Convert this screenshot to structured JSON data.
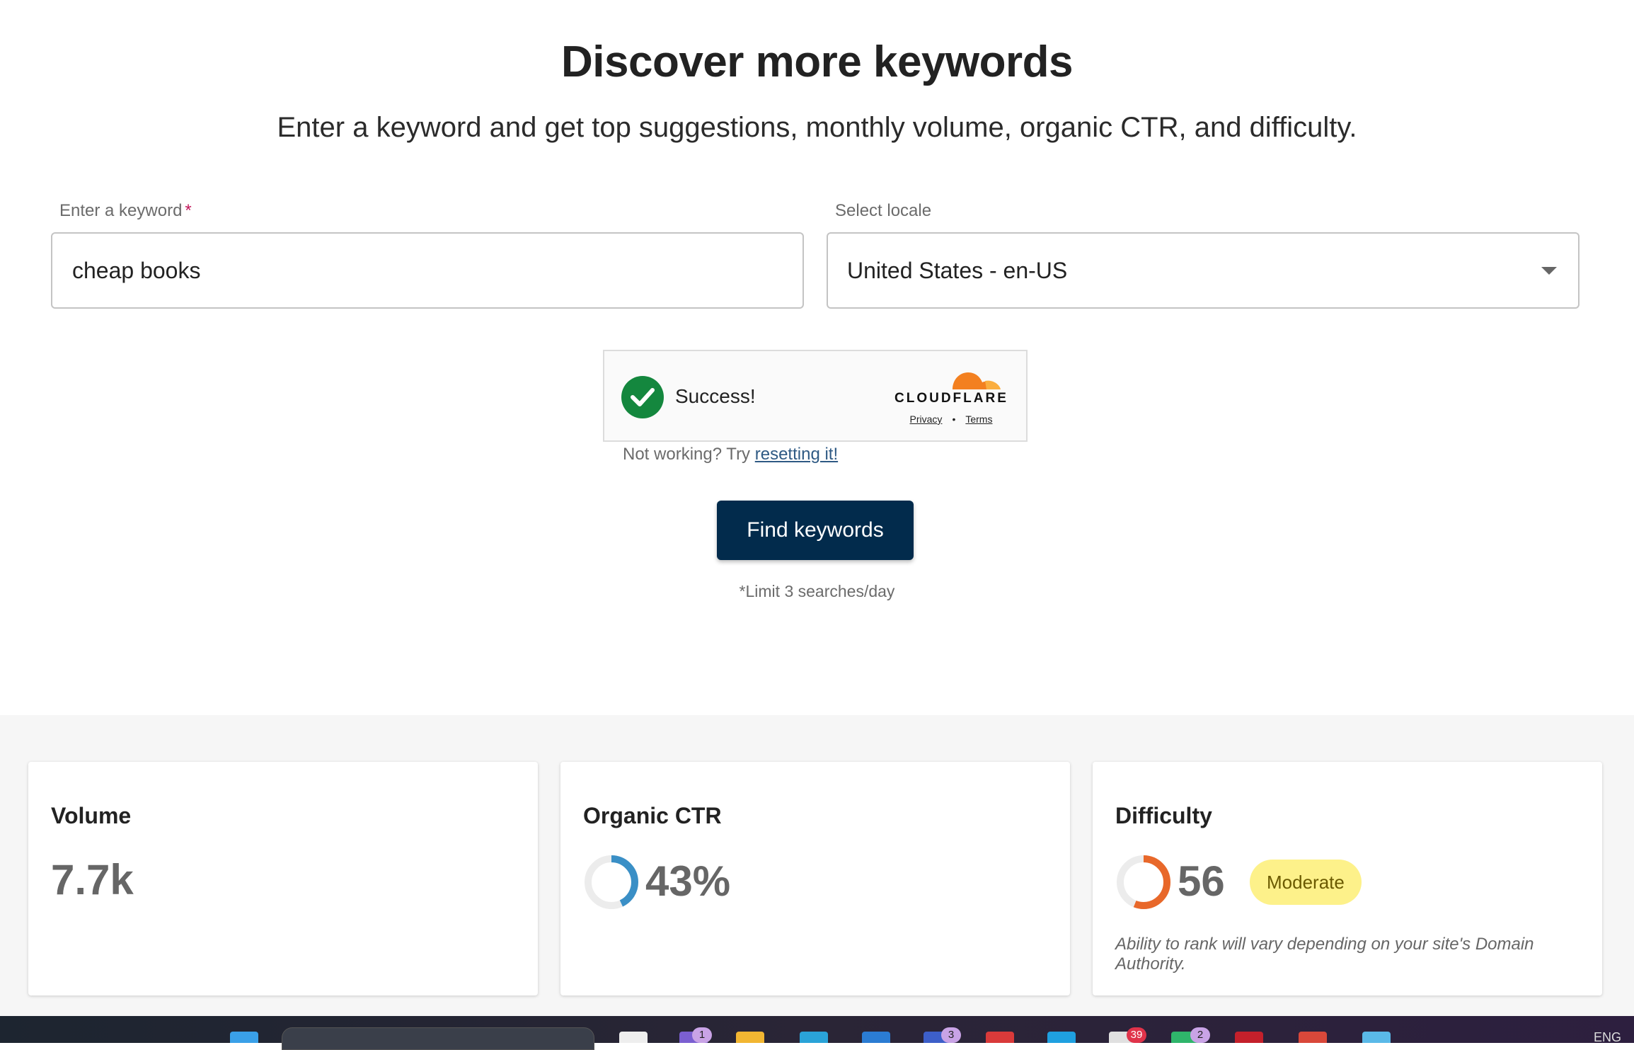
{
  "header": {
    "title": "Discover more keywords",
    "subtitle": "Enter a keyword and get top suggestions, monthly volume, organic CTR, and difficulty."
  },
  "form": {
    "keyword_label": "Enter a keyword",
    "keyword_required_mark": "*",
    "keyword_value": "cheap books",
    "locale_label": "Select locale",
    "locale_value": "United States - en-US"
  },
  "captcha": {
    "status": "Success!",
    "brand": "CLOUDFLARE",
    "privacy": "Privacy",
    "separator": "•",
    "terms": "Terms",
    "help_prefix": "Not working? Try",
    "help_link": "resetting it!"
  },
  "actions": {
    "find_label": "Find keywords",
    "limit_note": "*Limit 3 searches/day"
  },
  "metrics": {
    "volume": {
      "title": "Volume",
      "value": "7.7k"
    },
    "ctr": {
      "title": "Organic CTR",
      "value": "43%",
      "fraction": 0.43,
      "color": "#3a8fc6"
    },
    "difficulty": {
      "title": "Difficulty",
      "value": "56",
      "fraction": 0.56,
      "color": "#e8682a",
      "badge": "Moderate",
      "note": "Ability to rank will vary depending on your site's Domain Authority."
    }
  },
  "taskbar": {
    "badges": [
      "1",
      "3",
      "39",
      "2"
    ],
    "language": "ENG"
  },
  "colors": {
    "primary_button": "#022b4c",
    "success_green": "#14873e",
    "badge_yellow": "#fdf18a"
  }
}
